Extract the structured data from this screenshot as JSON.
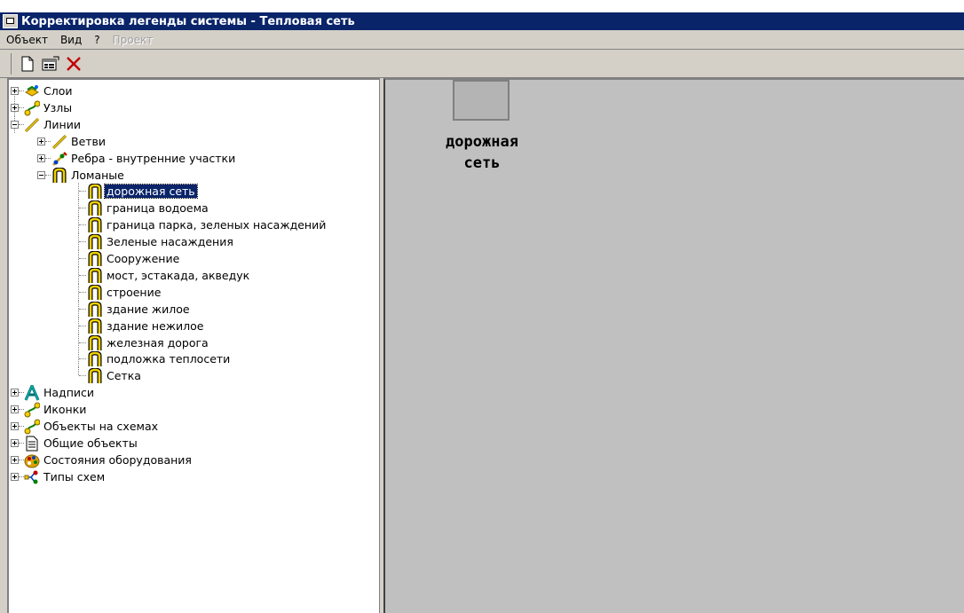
{
  "window": {
    "title": "Корректировка легенды системы - Тепловая сеть"
  },
  "menu": [
    {
      "label": "Объект",
      "enabled": true
    },
    {
      "label": "Вид",
      "enabled": true
    },
    {
      "label": "?",
      "enabled": true
    },
    {
      "label": "Проект",
      "enabled": false
    }
  ],
  "toolbar": {
    "buttons": [
      {
        "icon": "new-document-icon"
      },
      {
        "icon": "properties-icon"
      },
      {
        "icon": "delete-icon"
      }
    ]
  },
  "tree": {
    "nodes": [
      {
        "label": "Слои",
        "icon": "layers-icon",
        "expander": "plus"
      },
      {
        "label": "Узлы",
        "icon": "nodes-icon",
        "expander": "plus"
      },
      {
        "label": "Линии",
        "icon": "line-icon",
        "expander": "minus"
      },
      {
        "label": "Ветви",
        "icon": "line-icon",
        "expander": "plus"
      },
      {
        "label": "Ребра - внутренние участки",
        "icon": "edges-icon",
        "expander": "plus"
      },
      {
        "label": "Ломаные",
        "icon": "polyline-icon",
        "expander": "minus"
      },
      {
        "label": "дорожная сеть",
        "icon": "polyline-icon",
        "selected": true
      },
      {
        "label": "граница водоема",
        "icon": "polyline-icon"
      },
      {
        "label": "граница парка, зеленых насаждений",
        "icon": "polyline-icon"
      },
      {
        "label": "Зеленые насаждения",
        "icon": "polyline-icon"
      },
      {
        "label": "Сооружение",
        "icon": "polyline-icon"
      },
      {
        "label": "мост, эстакада, акведук",
        "icon": "polyline-icon"
      },
      {
        "label": "строение",
        "icon": "polyline-icon"
      },
      {
        "label": "здание жилое",
        "icon": "polyline-icon"
      },
      {
        "label": "здание нежилое",
        "icon": "polyline-icon"
      },
      {
        "label": "железная дорога",
        "icon": "polyline-icon"
      },
      {
        "label": "подложка теплосети",
        "icon": "polyline-icon"
      },
      {
        "label": "Сетка",
        "icon": "polyline-icon"
      },
      {
        "label": "Надписи",
        "icon": "text-a-icon",
        "expander": "plus"
      },
      {
        "label": "Иконки",
        "icon": "nodes-icon",
        "expander": "plus"
      },
      {
        "label": "Объекты на схемах",
        "icon": "nodes-icon",
        "expander": "plus"
      },
      {
        "label": "Общие объекты",
        "icon": "document-icon",
        "expander": "plus"
      },
      {
        "label": "Состояния оборудования",
        "icon": "palette-icon",
        "expander": "plus"
      },
      {
        "label": "Типы схем",
        "icon": "schema-icon",
        "expander": "plus"
      }
    ]
  },
  "preview": {
    "caption_line1": "дорожная",
    "caption_line2": "сеть",
    "swatch_color": "#b4b4b4"
  },
  "colors": {
    "titlebar": "#0a246a",
    "chrome": "#d4d0c8",
    "preview_bg": "#c0c0c0",
    "selection": "#0a246a",
    "polyline_icon": "#f0d000"
  }
}
